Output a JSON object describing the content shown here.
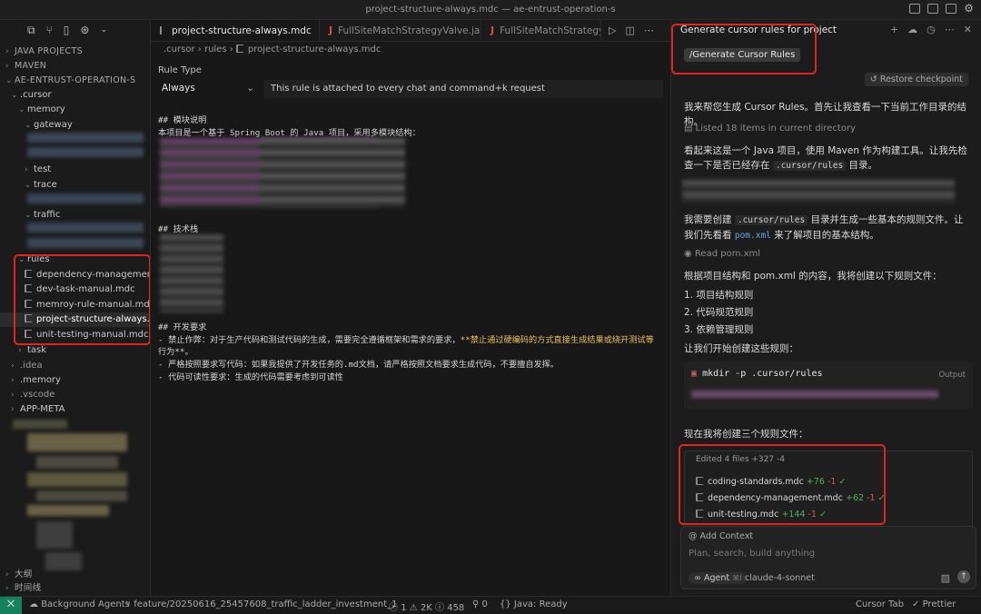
{
  "window": {
    "title": "project-structure-always.mdc — ae-entrust-operation-s"
  },
  "sidebar": {
    "sections": {
      "java_projects": "JAVA PROJECTS",
      "maven": "MAVEN",
      "project": "AE-ENTRUST-OPERATION-S",
      "app_meta": "APP-META",
      "outline": "大纲",
      "timeline": "时间线"
    },
    "folders": {
      "cursor": ".cursor",
      "memory": "memory",
      "gateway": "gateway",
      "test": "test",
      "trace": "trace",
      "traffic": "traffic",
      "rules": "rules",
      "task": "task",
      "idea": ".idea",
      "dot_memory": ".memory",
      "vscode": ".vscode"
    },
    "rule_files": [
      "dependency-management...",
      "dev-task-manual.mdc",
      "memroy-rule-manual.mdc",
      "project-structure-always....",
      "unit-testing-manual.mdc"
    ]
  },
  "editor": {
    "tabs": [
      {
        "label": "project-structure-always.mdc"
      },
      {
        "label": "FullSiteMatchStrategyValve.java"
      },
      {
        "label": "FullSiteMatchStrategyV"
      }
    ],
    "breadcrumb": [
      ".cursor",
      "rules",
      "project-structure-always.mdc"
    ],
    "rule_type_label": "Rule Type",
    "rule_type_value": "Always",
    "rule_desc": "This rule is attached to every chat and command+k request",
    "lines": {
      "h1": "## 模块说明",
      "l1": "本项目是一个基于 Spring Boot 的 Java 项目，采用多模块结构：",
      "h2": "## 技术栈",
      "h3": "## 开发要求",
      "r1a": "- 禁止作弊：对于生产代码和测试代码的生成，需要完全遵循框架和需求的要求，",
      "r1b": "**禁止通过硬编码的方式直接生成结果或绕开测试等",
      "r1c": "行为**。",
      "r2": "- 严格按照要求写代码：如果我提供了开发任务的.md文档，请严格按照文档要求生成代码，不要擅自发挥。",
      "r3": "- 代码可读性要求：生成的代码需要考虑到可读性"
    }
  },
  "chat": {
    "title": "Generate cursor rules for project",
    "command": "/Generate Cursor Rules",
    "restore": "Restore checkpoint",
    "p1": "我来帮您生成 Cursor Rules。首先让我查看一下当前工作目录的结构。",
    "listed": "Listed 18 items in current directory",
    "p2a": "看起来这是一个 Java 项目，使用 Maven 作为构建工具。让我先检查一下是否已经存在",
    "p2code": ".cursor/rules",
    "p2b": "目录。",
    "p3a": "我需要创建",
    "p3code": ".cursor/rules",
    "p3b": "目录并生成一些基本的规则文件。让我们先看看",
    "p3link": "pom.xml",
    "p3c": "来了解项目的基本结构。",
    "read": "Read pom.xml",
    "p4": "根据项目结构和 pom.xml 的内容，我将创建以下规则文件：",
    "list": [
      "1. 项目结构规则",
      "2. 代码规范规则",
      "3. 依赖管理规则"
    ],
    "p5": "让我们开始创建这些规则：",
    "cmd": "mkdir -p .cursor/rules",
    "output": "Output",
    "p6": "现在我将创建三个规则文件：",
    "edited_head": "Edited 4 files +327 -4",
    "edited_files": [
      {
        "name": "coding-standards.mdc",
        "add": "+76",
        "del": "-1"
      },
      {
        "name": "dependency-management.mdc",
        "add": "+62",
        "del": "-1"
      },
      {
        "name": "unit-testing.mdc",
        "add": "+144",
        "del": "-1"
      }
    ],
    "add_context": "Add Context",
    "placeholder": "Plan, search, build anything",
    "agent": "Agent",
    "agent_key": "⌘I",
    "model": "claude-4-sonnet"
  },
  "status": {
    "background_agents": "Background Agents",
    "branch": "feature/20250616_25457608_traffic_ladder_investment_1",
    "errors": "1",
    "warnings": "2K",
    "info": "458",
    "ports": "0",
    "java": "Java: Ready",
    "cursor_tab": "Cursor Tab",
    "prettier": "Prettier"
  }
}
